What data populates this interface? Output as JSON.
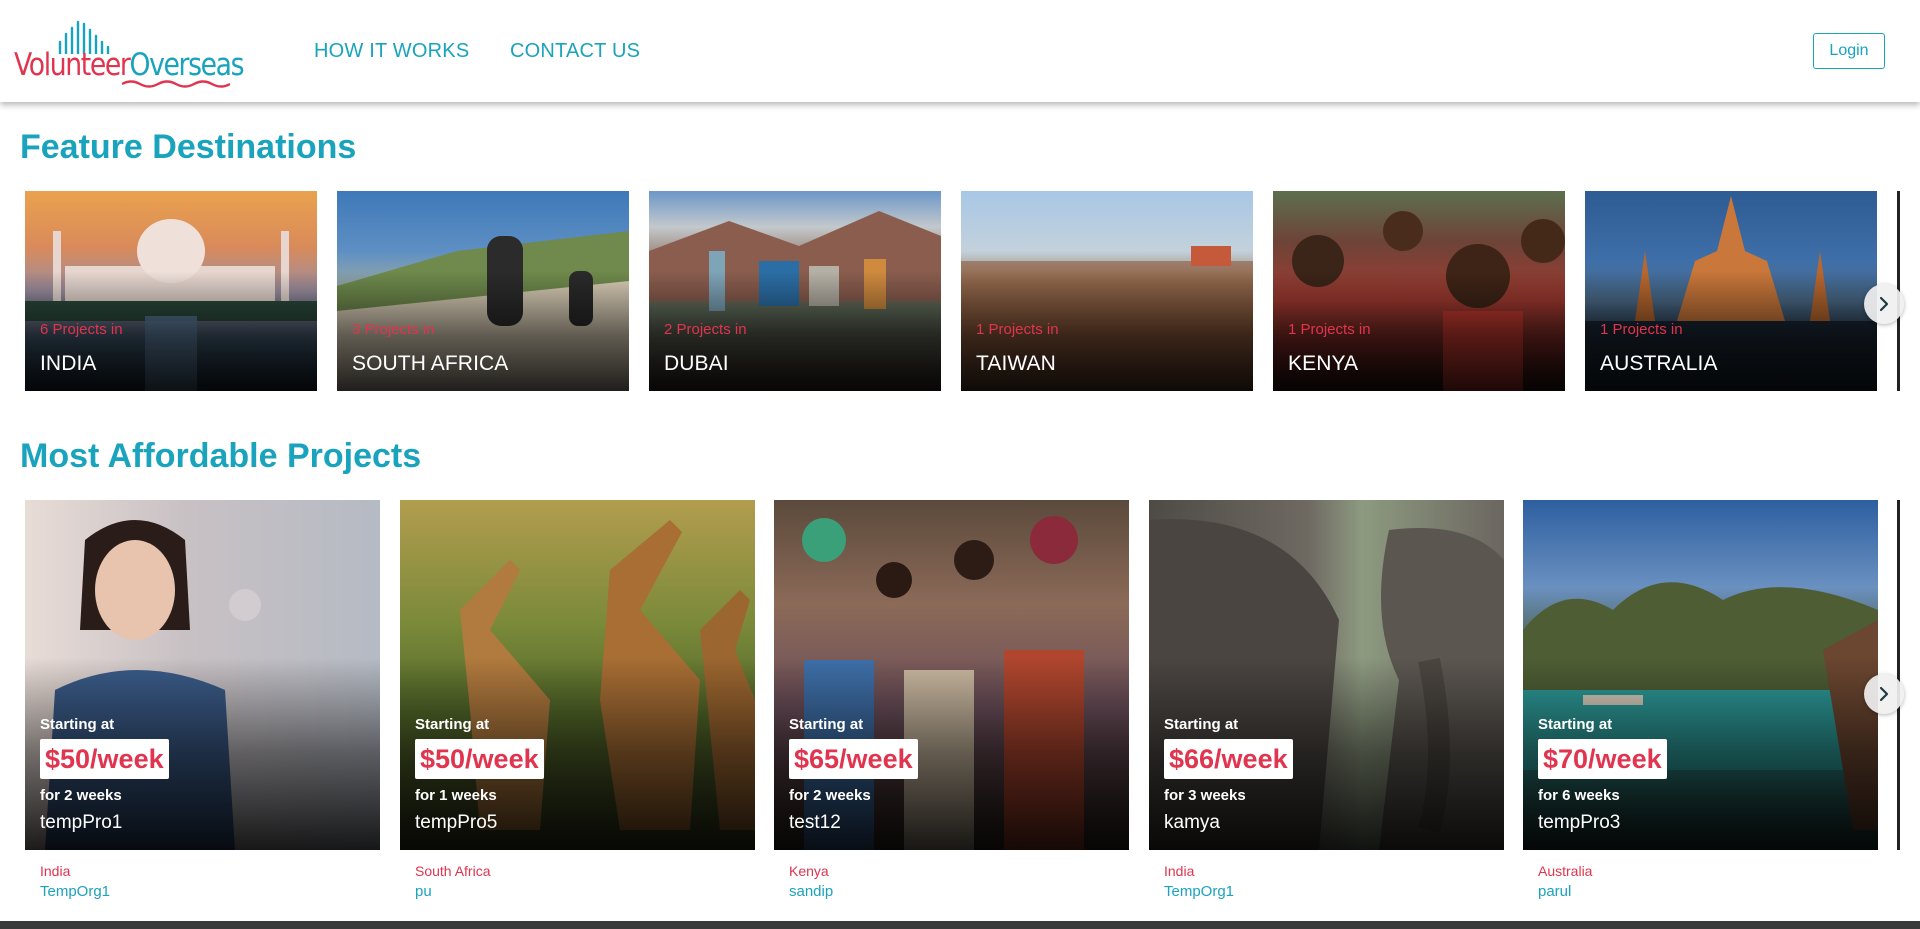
{
  "brand": {
    "word1": "Volunteer",
    "word2": "Overseas",
    "primary_color": "#1aa3bd",
    "accent_color": "#e0344f"
  },
  "nav": {
    "how_it_works": "HOW IT WORKS",
    "contact_us": "CONTACT US",
    "login": "Login"
  },
  "featured": {
    "title": "Feature Destinations",
    "items": [
      {
        "count": "6 Projects in",
        "name": "INDIA"
      },
      {
        "count": "3 Projects in",
        "name": "SOUTH AFRICA"
      },
      {
        "count": "2 Projects in",
        "name": "DUBAI"
      },
      {
        "count": "1 Projects in",
        "name": "TAIWAN"
      },
      {
        "count": "1 Projects in",
        "name": "KENYA"
      },
      {
        "count": "1 Projects in",
        "name": "AUSTRALIA"
      }
    ]
  },
  "affordable": {
    "title": "Most Affordable Projects",
    "starting_label": "Starting at",
    "items": [
      {
        "price": "$50/week",
        "duration": "for 2 weeks",
        "name": "tempPro1",
        "country": "India",
        "org": "TempOrg1"
      },
      {
        "price": "$50/week",
        "duration": "for 1 weeks",
        "name": "tempPro5",
        "country": "South Africa",
        "org": "pu"
      },
      {
        "price": "$65/week",
        "duration": "for 2 weeks",
        "name": "test12",
        "country": "Kenya",
        "org": "sandip"
      },
      {
        "price": "$66/week",
        "duration": "for 3 weeks",
        "name": "kamya",
        "country": "India",
        "org": "TempOrg1"
      },
      {
        "price": "$70/week",
        "duration": "for 6 weeks",
        "name": "tempPro3",
        "country": "Australia",
        "org": "parul"
      }
    ]
  },
  "icons": {
    "carousel_next": "chevron-right-icon"
  }
}
